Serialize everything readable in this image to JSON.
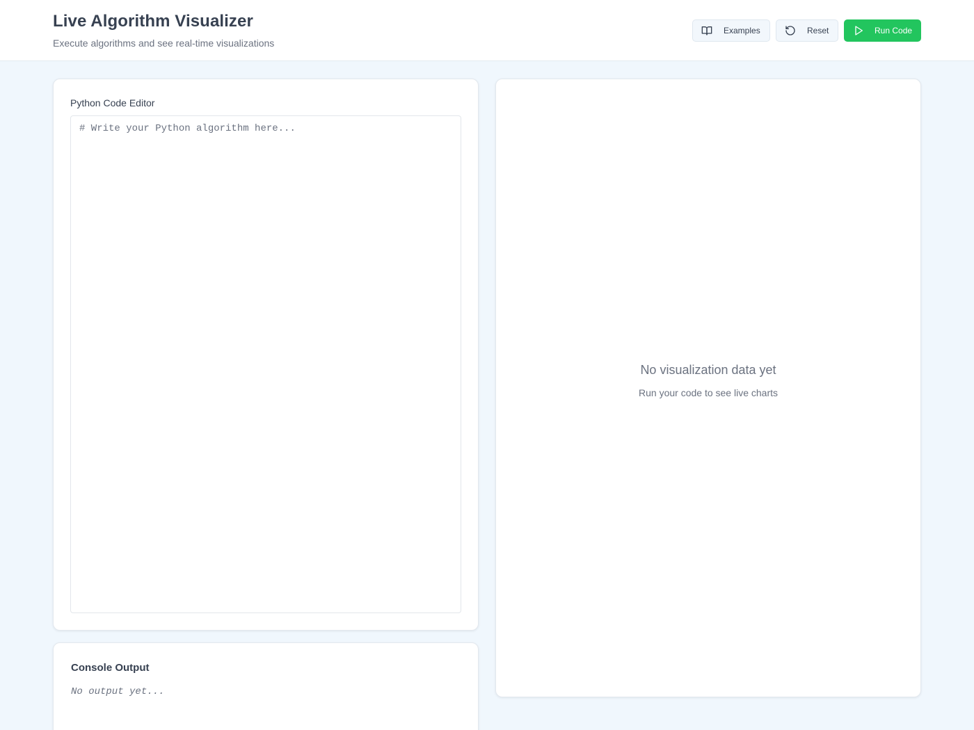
{
  "header": {
    "title": "Live Algorithm Visualizer",
    "subtitle": "Execute algorithms and see real-time visualizations",
    "buttons": {
      "examples": {
        "label": "Examples",
        "icon": "book-open-icon"
      },
      "reset": {
        "label": "Reset",
        "icon": "rotate-ccw-icon"
      },
      "run": {
        "label": "Run Code",
        "icon": "play-icon"
      }
    }
  },
  "editor": {
    "label": "Python Code Editor",
    "value": "",
    "placeholder": "# Write your Python algorithm here..."
  },
  "console": {
    "title": "Console Output",
    "output": "No output yet..."
  },
  "visualization": {
    "empty_title": "No visualization data yet",
    "empty_subtitle": "Run your code to see live charts"
  },
  "colors": {
    "page_background": "#f0f7fd",
    "accent_green": "#22c55e",
    "text_primary": "#374151",
    "text_muted": "#6b7280"
  }
}
